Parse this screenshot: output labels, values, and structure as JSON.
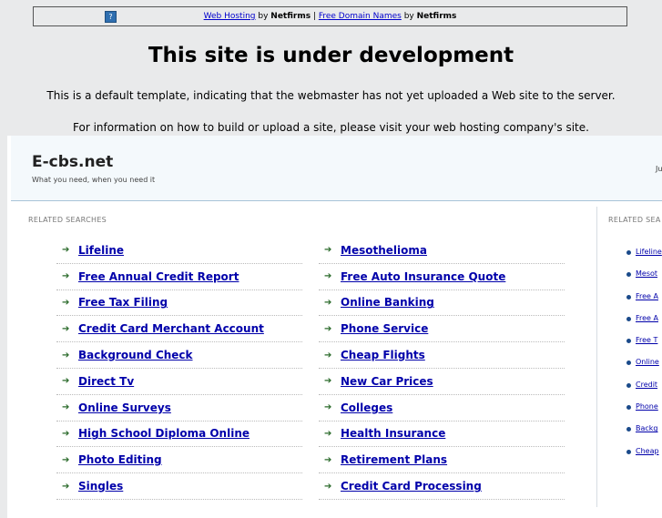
{
  "topbar": {
    "help_glyph": "?",
    "link1": "Web Hosting",
    "by1": " by ",
    "brand1": "Netfirms",
    "sep": " | ",
    "link2": "Free Domain Names",
    "by2": " by ",
    "brand2": "Netfirms"
  },
  "notice": {
    "headline": "This site is under development",
    "line1": "This is a default template, indicating that the webmaster has not yet uploaded a Web site to the server.",
    "line2": "For information on how to build or upload a site, please visit your web hosting company's site."
  },
  "site": {
    "brand": "E-cbs.net",
    "tagline": "What you need, when you need it",
    "date_fragment": "Ju"
  },
  "main": {
    "related_label": "RELATED SEARCHES",
    "left_col": [
      "Lifeline",
      "Free Annual Credit Report",
      "Free Tax Filing",
      "Credit Card Merchant Account",
      "Background Check",
      "Direct Tv",
      "Online Surveys",
      "High School Diploma Online",
      "Photo Editing",
      "Singles"
    ],
    "right_col": [
      "Mesothelioma",
      "Free Auto Insurance Quote",
      "Online Banking",
      "Phone Service",
      "Cheap Flights",
      "New Car Prices",
      "Colleges",
      "Health Insurance",
      "Retirement Plans",
      "Credit Card Processing"
    ]
  },
  "sidebar": {
    "related_label": "RELATED SEA",
    "items": [
      "Lifeline",
      "Mesot",
      "Free A",
      "Free A",
      "Free T",
      "Online",
      "Credit",
      "Phone",
      "Backg",
      "Cheap"
    ]
  }
}
